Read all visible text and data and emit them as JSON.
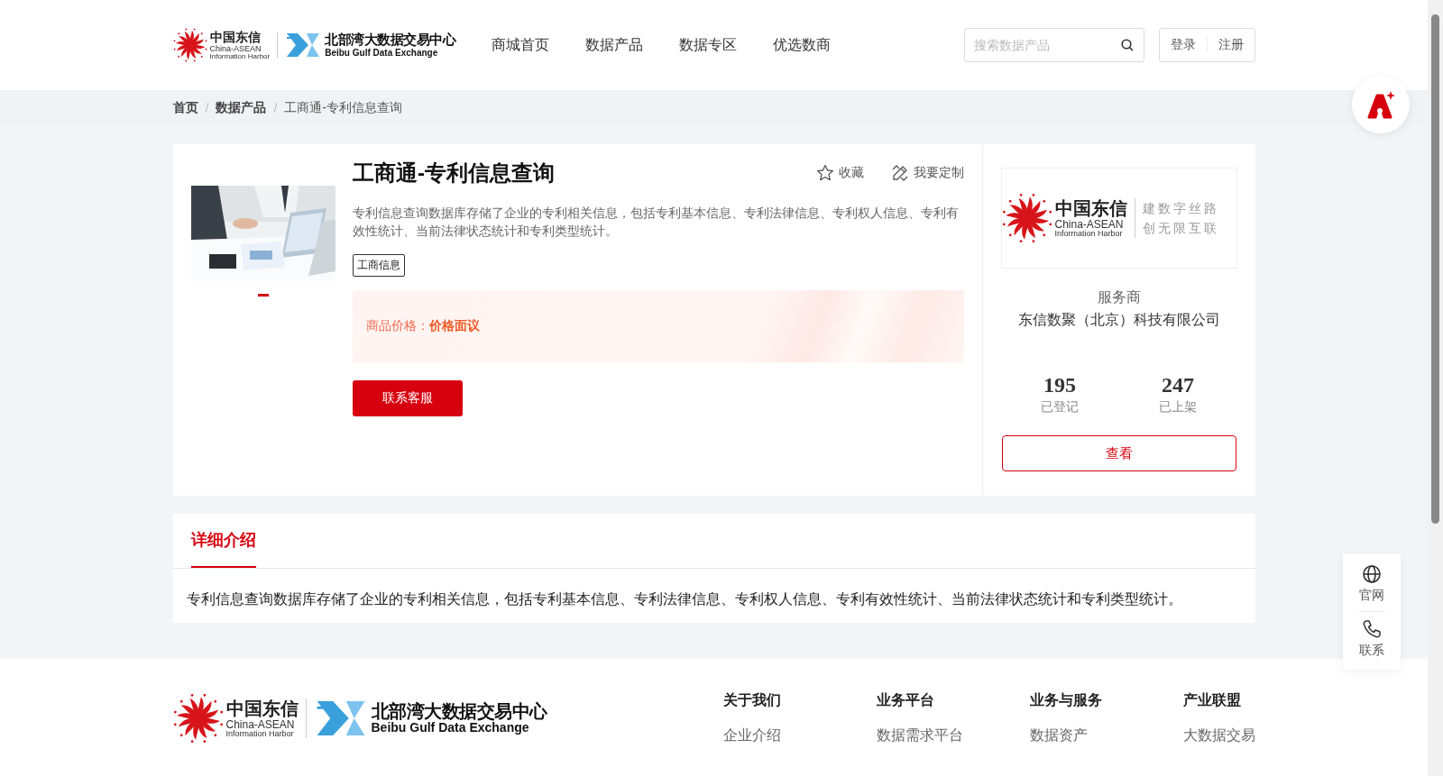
{
  "header": {
    "logo": {
      "cn": "中国东信",
      "en_1": "China-ASEAN",
      "en_2": "Information Harbor",
      "exchange_cn": "北部湾大数据交易中心",
      "exchange_en": "Beibu Gulf Data Exchange"
    },
    "nav": [
      {
        "label": "商城首页"
      },
      {
        "label": "数据产品"
      },
      {
        "label": "数据专区"
      },
      {
        "label": "优选数商"
      }
    ],
    "search": {
      "placeholder": "搜索数据产品"
    },
    "auth": [
      "登录",
      "注册"
    ]
  },
  "breadcrumb": [
    {
      "label": "首页",
      "kind": "link"
    },
    {
      "separator": "/",
      "label": "数据产品",
      "kind": "link"
    },
    {
      "separator": "/",
      "label": "工商通-专利信息查询",
      "kind": "current"
    }
  ],
  "product": {
    "title": "工商通-专利信息查询",
    "actions": [
      {
        "label": "收藏",
        "kind": "star"
      },
      {
        "label": "我要定制",
        "kind": "custom"
      }
    ],
    "description": "专利信息查询数据库存储了企业的专利相关信息，包括专利基本信息、专利法律信息、专利权人信息、专利有效性统计、当前法律状态统计和专利类型统计。",
    "tags": [
      "工商信息"
    ],
    "carousel": [
      {
        "selected": true
      }
    ],
    "price": {
      "label": "商品价格：",
      "value": "价格面议"
    },
    "button": "联系客服"
  },
  "provider": {
    "logo": {
      "cn": "中国东信",
      "en_1": "China-ASEAN",
      "en_2": "Information Harbor",
      "slogan_1": "建数字丝路",
      "slogan_2": "创无限互联"
    },
    "label": "服务商",
    "name": "东信数聚（北京）科技有限公司",
    "stats": [
      {
        "value": "195",
        "label": "已登记"
      },
      {
        "value": "247",
        "label": "已上架"
      }
    ],
    "button": "查看"
  },
  "detail": {
    "tabs": [
      {
        "label": "详细介绍",
        "selected": true
      }
    ],
    "text": "专利信息查询数据库存储了企业的专利相关信息，包括专利基本信息、专利法律信息、专利权人信息、专利有效性统计、当前法律状态统计和专利类型统计。"
  },
  "side_panel": [
    {
      "label": "官网",
      "kind": "globe"
    },
    {
      "label": "联系",
      "kind": "phone"
    }
  ],
  "footer": {
    "logo": {
      "cn": "中国东信",
      "en_1": "China-ASEAN",
      "en_2": "Information Harbor",
      "exchange_cn": "北部湾大数据交易中心",
      "exchange_en": "Beibu Gulf Data Exchange"
    },
    "columns": [
      {
        "title": "关于我们",
        "links": [
          "企业介绍"
        ]
      },
      {
        "title": "业务平台",
        "links": [
          "数据需求平台"
        ]
      },
      {
        "title": "业务与服务",
        "links": [
          "数据资产"
        ]
      },
      {
        "title": "产业联盟",
        "links": [
          "大数据交易"
        ]
      }
    ]
  }
}
